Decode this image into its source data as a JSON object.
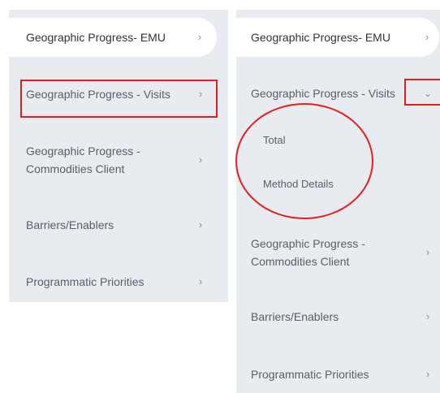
{
  "left_panel": {
    "items": [
      {
        "label": "Geographic Progress- EMU",
        "chevron": "›"
      },
      {
        "label": "Geographic Progress - Visits",
        "chevron": "›"
      },
      {
        "label_line1": "Geographic Progress -",
        "label_line2": "Commodities Client",
        "chevron": "›"
      },
      {
        "label": "Barriers/Enablers",
        "chevron": "›"
      },
      {
        "label": "Programmatic Priorities",
        "chevron": "›"
      }
    ]
  },
  "right_panel": {
    "items": [
      {
        "label": "Geographic Progress- EMU",
        "chevron": "›"
      },
      {
        "label": "Geographic Progress - Visits",
        "chevron": "⌄"
      },
      {
        "label_line1": "Geographic Progress -",
        "label_line2": "Commodities Client",
        "chevron": "›"
      },
      {
        "label": "Barriers/Enablers",
        "chevron": "›"
      },
      {
        "label": "Programmatic Priorities",
        "chevron": "›"
      }
    ],
    "subitems": [
      "Total",
      "Method Details"
    ]
  },
  "colors": {
    "panel_bg": "#e8ebef",
    "active_bg": "#ffffff",
    "annotation": "#e0201f"
  }
}
